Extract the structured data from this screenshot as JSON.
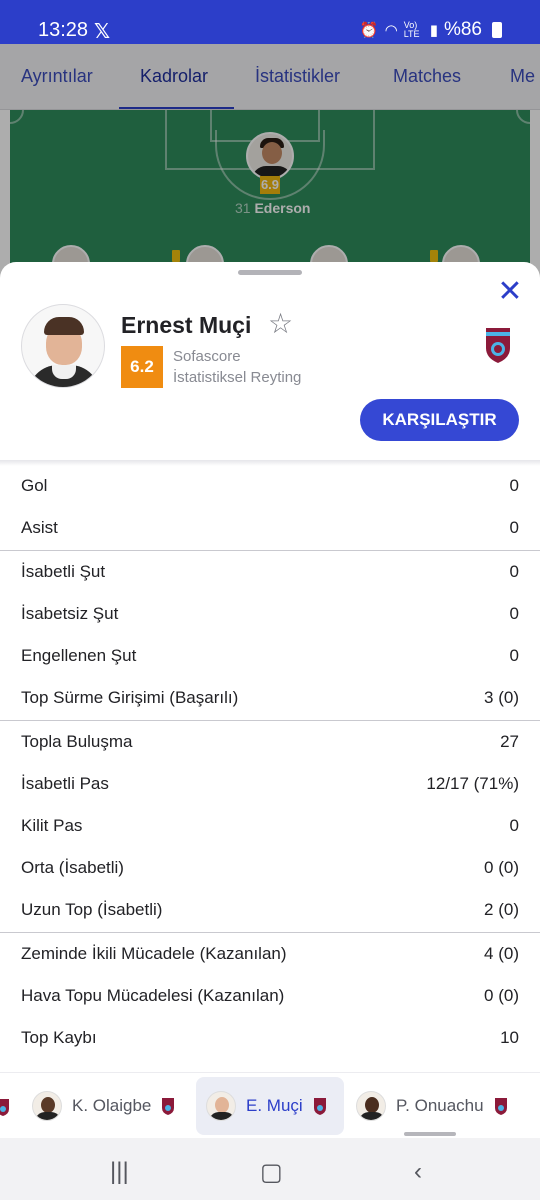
{
  "status_bar": {
    "time": "13:28",
    "network_label": "Vo) LTE",
    "battery": "%86"
  },
  "tabs": [
    {
      "label": "Ayrıntılar",
      "active": false
    },
    {
      "label": "Kadrolar",
      "active": true
    },
    {
      "label": "İstatistikler",
      "active": false
    },
    {
      "label": "Matches",
      "active": false
    },
    {
      "label": "Me",
      "active": false
    }
  ],
  "pitch": {
    "goalkeeper": {
      "number": "31",
      "name": "Ederson",
      "rating": "6.9"
    }
  },
  "player_sheet": {
    "name": "Ernest Muçi",
    "rating": "6.2",
    "rating_source": "Sofascore",
    "rating_label": "İstatistiksel Reyting",
    "compare_label": "KARŞILAŞTIR",
    "rating_color": "#f08c11"
  },
  "stats": [
    {
      "label": "Gol",
      "value": "0"
    },
    {
      "label": "Asist",
      "value": "0"
    },
    {
      "label": "İsabetli Şut",
      "value": "0"
    },
    {
      "label": "İsabetsiz Şut",
      "value": "0"
    },
    {
      "label": "Engellenen Şut",
      "value": "0"
    },
    {
      "label": "Top Sürme Girişimi (Başarılı)",
      "value": "3 (0)"
    },
    {
      "label": "Topla Buluşma",
      "value": "27"
    },
    {
      "label": "İsabetli Pas",
      "value": "12/17 (71%)"
    },
    {
      "label": "Kilit Pas",
      "value": "0"
    },
    {
      "label": "Orta (İsabetli)",
      "value": "0 (0)"
    },
    {
      "label": "Uzun Top (İsabetli)",
      "value": "2 (0)"
    },
    {
      "label": "Zeminde İkili Mücadele (Kazanılan)",
      "value": "4 (0)"
    },
    {
      "label": "Hava Topu Mücadelesi (Kazanılan)",
      "value": "0 (0)"
    },
    {
      "label": "Top Kaybı",
      "value": "10"
    }
  ],
  "switcher": [
    {
      "name": "K. Olaigbe",
      "active": false
    },
    {
      "name": "E. Muçi",
      "active": true
    },
    {
      "name": "P. Onuachu",
      "active": false
    }
  ],
  "colors": {
    "brand_blue": "#2c3ec9",
    "pitch_green": "#2e8c5c",
    "club_maroon": "#8b1a3a",
    "club_blue": "#4bb3e6"
  }
}
